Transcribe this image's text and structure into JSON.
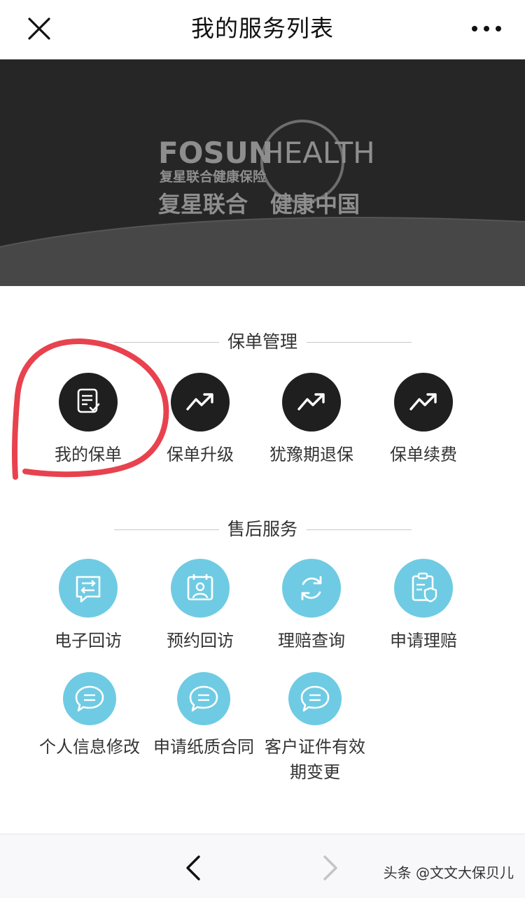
{
  "header": {
    "title": "我的服务列表"
  },
  "banner": {
    "brand_en_left": "FOSUN",
    "brand_en_right": "HEALTH",
    "brand_cn_small": "复星联合健康保险",
    "slogan_left": "复星联合",
    "slogan_right": "健康中国"
  },
  "policy_section": {
    "title": "保单管理",
    "items": [
      {
        "label": "我的保单",
        "icon": "document-check-icon"
      },
      {
        "label": "保单升级",
        "icon": "trend-up-icon"
      },
      {
        "label": "犹豫期退保",
        "icon": "trend-up-icon"
      },
      {
        "label": "保单续费",
        "icon": "trend-up-icon"
      }
    ]
  },
  "after_sales_section": {
    "title": "售后服务",
    "items": [
      {
        "label": "电子回访",
        "icon": "transfer-chat-icon"
      },
      {
        "label": "预约回访",
        "icon": "person-calendar-icon"
      },
      {
        "label": "理赔查询",
        "icon": "refresh-icon"
      },
      {
        "label": "申请理赔",
        "icon": "claim-clipboard-icon"
      },
      {
        "label": "个人信息修改",
        "icon": "chat-bubble-icon"
      },
      {
        "label": "申请纸质合同",
        "icon": "chat-bubble-icon"
      },
      {
        "label": "客户证件有效",
        "label_line2": "期变更",
        "icon": "chat-bubble-icon"
      }
    ]
  },
  "watermark": "头条 @文文大保贝儿",
  "colors": {
    "dark_icon_bg": "#1f1f1f",
    "blue_icon_bg": "#6fcbe3",
    "annotation_red": "#e8424f",
    "banner_bg": "#262626"
  }
}
